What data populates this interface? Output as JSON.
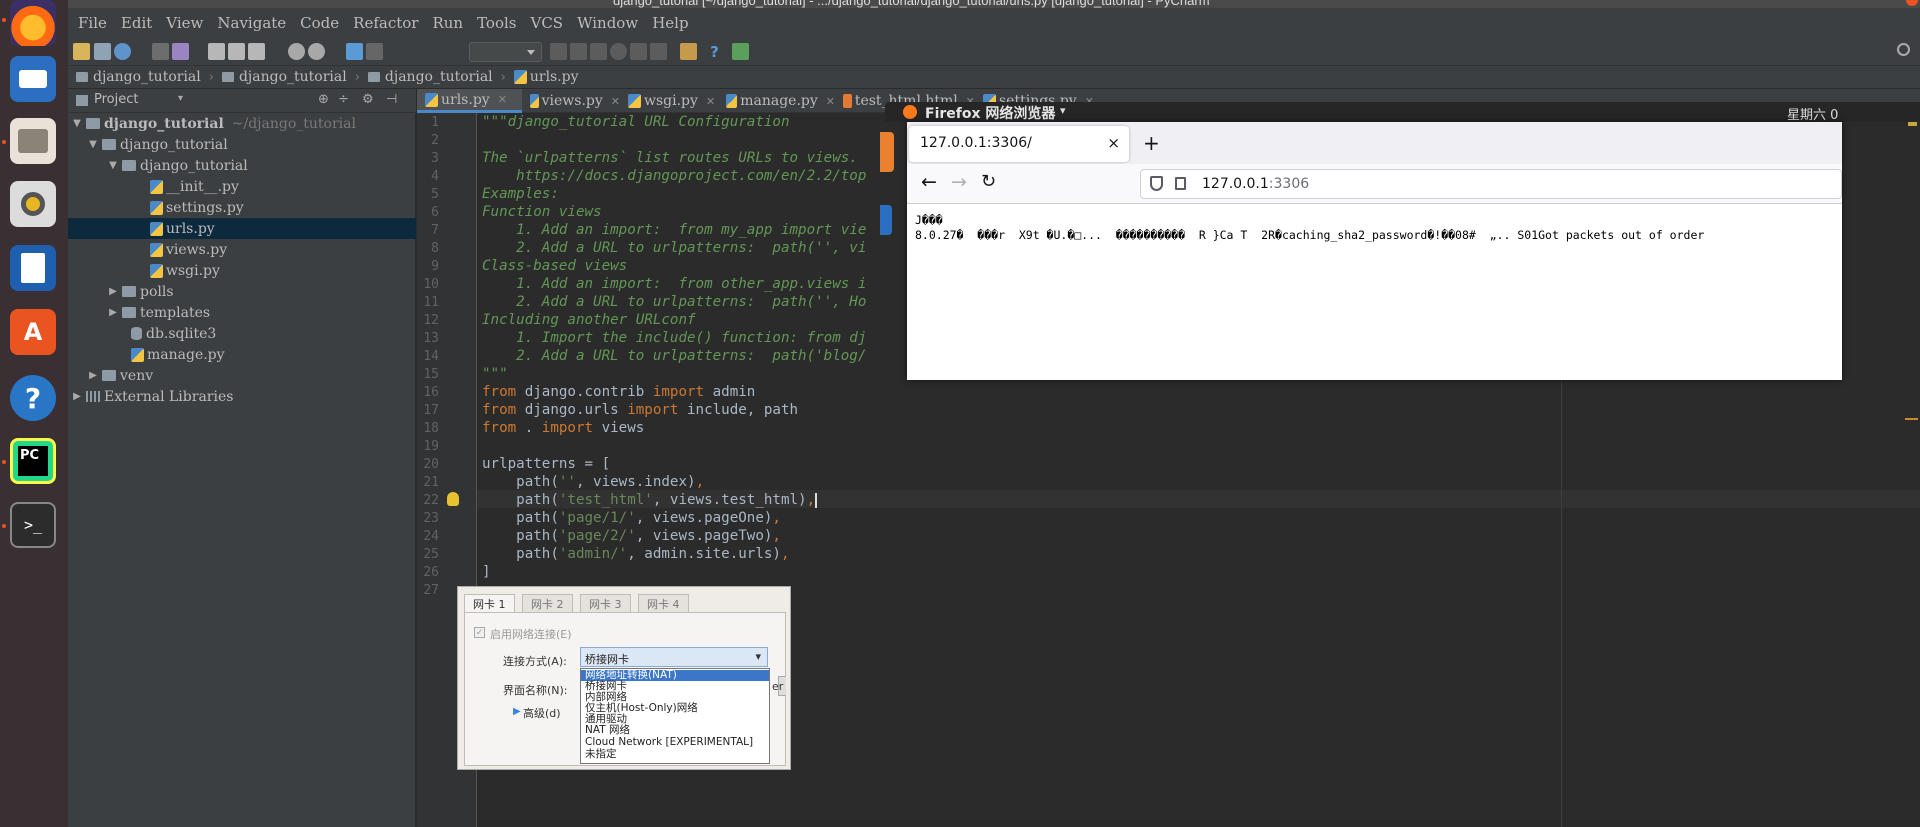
{
  "window_title": "django_tutorial [~/django_tutorial] - .../django_tutorial/django_tutorial/urls.py [django_tutorial] - PyCharm",
  "menu": [
    "File",
    "Edit",
    "View",
    "Navigate",
    "Code",
    "Refactor",
    "Run",
    "Tools",
    "VCS",
    "Window",
    "Help"
  ],
  "breadcrumbs": [
    "django_tutorial",
    "django_tutorial",
    "django_tutorial",
    "urls.py"
  ],
  "project_panel": {
    "title": "Project",
    "tree": [
      {
        "label": "django_tutorial",
        "hint": "~/django_tutorial",
        "type": "folder",
        "expanded": true
      },
      {
        "label": "django_tutorial",
        "type": "folder",
        "expanded": true
      },
      {
        "label": "django_tutorial",
        "type": "folder",
        "expanded": true
      },
      {
        "label": "__init__.py",
        "type": "py"
      },
      {
        "label": "settings.py",
        "type": "py"
      },
      {
        "label": "urls.py",
        "type": "py",
        "selected": true
      },
      {
        "label": "views.py",
        "type": "py"
      },
      {
        "label": "wsgi.py",
        "type": "py"
      },
      {
        "label": "polls",
        "type": "folder",
        "expanded": false
      },
      {
        "label": "templates",
        "type": "folder",
        "expanded": false
      },
      {
        "label": "db.sqlite3",
        "type": "db"
      },
      {
        "label": "manage.py",
        "type": "py"
      },
      {
        "label": "venv",
        "type": "folder",
        "expanded": false
      },
      {
        "label": "External Libraries",
        "type": "lib",
        "expanded": false
      }
    ]
  },
  "editor_tabs": [
    "urls.py",
    "views.py",
    "wsgi.py",
    "manage.py",
    "test_html.html",
    "settings.py"
  ],
  "active_tab": "urls.py",
  "code": {
    "l1": "\"\"\"django_tutorial URL Configuration",
    "l3": "The `urlpatterns` list routes URLs to views.",
    "l4": "    https://docs.djangoproject.com/en/2.2/top",
    "l5": "Examples:",
    "l6": "Function views",
    "l7": "    1. Add an import:  from my_app import vie",
    "l8": "    2. Add a URL to urlpatterns:  path('', vi",
    "l9": "Class-based views",
    "l10": "    1. Add an import:  from other_app.views i",
    "l11": "    2. Add a URL to urlpatterns:  path('', Ho",
    "l12": "Including another URLconf",
    "l13": "    1. Import the include() function: from dj",
    "l14": "    2. Add a URL to urlpatterns:  path('blog/",
    "l15": "\"\"\"",
    "l16_kw1": "from",
    "l16_mid": " django.contrib ",
    "l16_kw2": "import",
    "l16_end": " admin",
    "l17_kw1": "from",
    "l17_mid": " django.urls ",
    "l17_kw2": "import",
    "l17_end": " include, path",
    "l18_kw1": "from",
    "l18_mid": " . ",
    "l18_kw2": "import",
    "l18_end": " views",
    "l20": "urlpatterns = [",
    "l21_a": "    path(",
    "l21_s": "''",
    "l21_b": ", views.index)",
    "l21_c": ",",
    "l22_a": "    path(",
    "l22_s": "'test_html'",
    "l22_b": ", views.test_html)",
    "l22_c": ",",
    "l23_a": "    path(",
    "l23_s": "'page/1/'",
    "l23_b": ", views.pageOne)",
    "l23_c": ",",
    "l24_a": "    path(",
    "l24_s": "'page/2/'",
    "l24_b": ", views.pageTwo)",
    "l24_c": ",",
    "l25_a": "    path(",
    "l25_s": "'admin/'",
    "l25_b": ", admin.site.urls)",
    "l25_c": ",",
    "l26": "]"
  },
  "line_numbers": [
    "1",
    "2",
    "3",
    "4",
    "5",
    "6",
    "7",
    "8",
    "9",
    "10",
    "11",
    "12",
    "13",
    "14",
    "15",
    "16",
    "17",
    "18",
    "19",
    "20",
    "21",
    "22",
    "23",
    "24",
    "25",
    "26",
    "27"
  ],
  "firefox": {
    "title": "Firefox 网络浏览器",
    "top_clock": "星期六 0",
    "tab_title": "127.0.0.1:3306/",
    "url_host": "127.0.0.1",
    "url_port": ":3306",
    "content_line1": "J���",
    "content_line2": "8.0.27�  ���r  X9t �U.�□...  ����������  R }Ca T  2R�caching_sha2_password�!��08#  „.. S01Got packets out of order"
  },
  "vbox_dialog": {
    "tabs": [
      "网卡 1",
      "网卡 2",
      "网卡 3",
      "网卡 4"
    ],
    "enable_label": "启用网络连接(E)",
    "attach_label": "连接方式(A):",
    "attach_value": "桥接网卡",
    "name_label": "界面名称(N):",
    "advanced_label": "高级(d)",
    "name_value_tail": "er",
    "options": [
      "网络地址转换(NAT)",
      "桥接网卡",
      "内部网络",
      "仅主机(Host-Only)网络",
      "通用驱动",
      "NAT 网络",
      "Cloud Network [EXPERIMENTAL]",
      "未指定"
    ]
  },
  "colors": {
    "accent": "#4a88c7",
    "selection": "#0d293e",
    "launcher": "#3a2f33",
    "ubuntu_orange": "#e95420"
  }
}
